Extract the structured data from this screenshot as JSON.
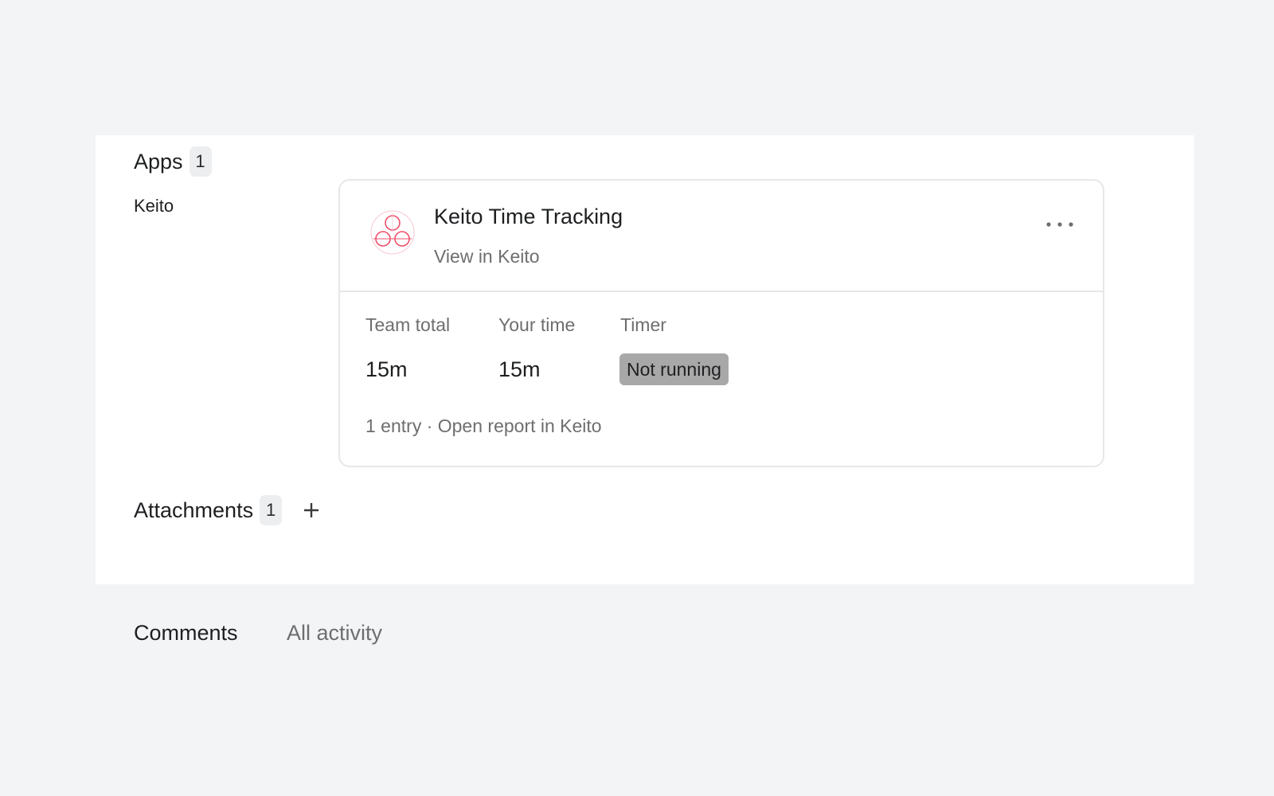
{
  "apps": {
    "title": "Apps",
    "count": "1",
    "app_label": "Keito",
    "card": {
      "title": "Keito Time Tracking",
      "link": "View in Keito",
      "more_icon": "more-horizontal-icon",
      "logo_icon": "keito-logo-icon",
      "stats": [
        {
          "label": "Team total",
          "value": "15m"
        },
        {
          "label": "Your time",
          "value": "15m"
        },
        {
          "label": "Timer",
          "value": "Not running"
        }
      ],
      "footer": "1 entry · Open report in Keito"
    }
  },
  "attachments": {
    "title": "Attachments",
    "count": "1",
    "add_icon": "plus-icon"
  },
  "tabs": [
    {
      "label": "Comments",
      "active": true
    },
    {
      "label": "All activity",
      "active": false
    }
  ],
  "colors": {
    "logo_accent": "#ef4f6b",
    "status_pill": "#a8a8a8",
    "muted_text": "#6d6e6f",
    "border": "#e6e7e9"
  }
}
